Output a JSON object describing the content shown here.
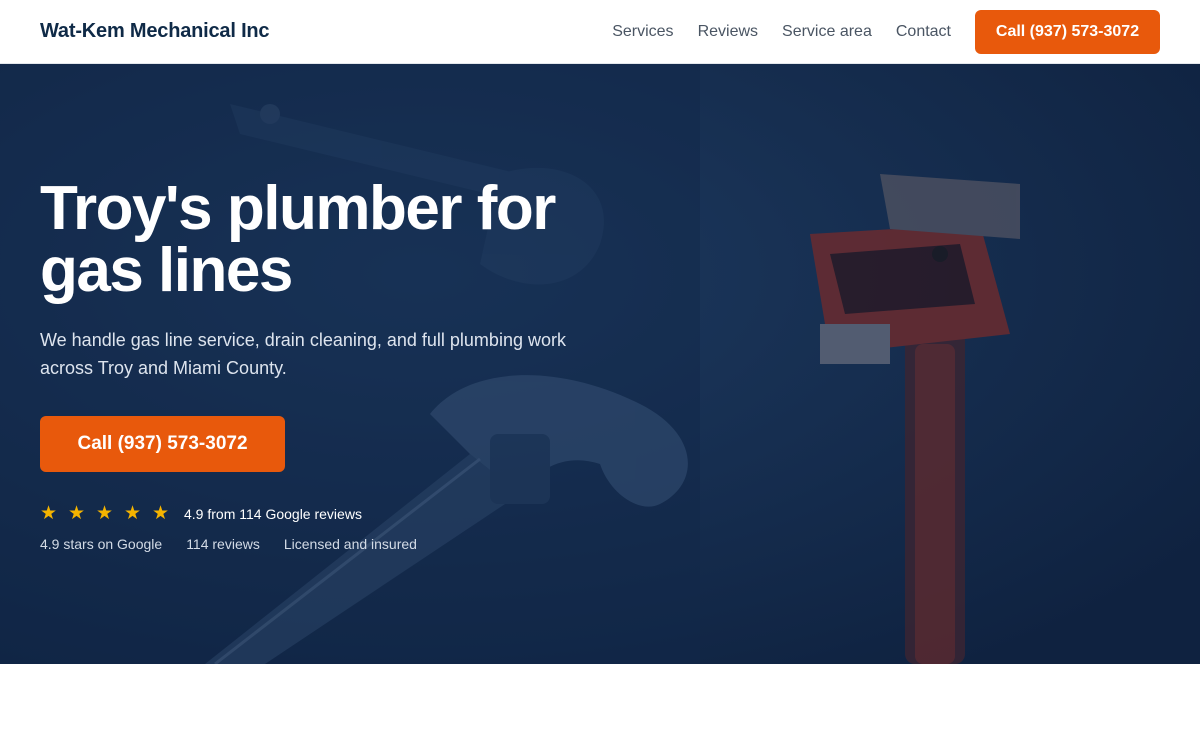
{
  "header": {
    "brand": "Wat-Kem Mechanical Inc",
    "nav": [
      "Services",
      "Reviews",
      "Service area",
      "Contact"
    ],
    "cta_label": "Call (937) 573-3072"
  },
  "hero": {
    "title_line1": "Troy's plumber for",
    "title_line2": "gas lines",
    "subtitle": "We handle gas line service, drain cleaning, and full plumbing work across Troy and Miami County.",
    "cta_label": "Call (937) 573-3072",
    "rating": {
      "stars": 5,
      "star_icon": "star-icon",
      "text": "4.9 from 114 Google reviews"
    },
    "trust": [
      "4.9 stars on Google",
      "114 reviews",
      "Licensed and insured"
    ],
    "background_image": "tools-photo (wrenches, dark navy overlay)"
  },
  "colors": {
    "navy": "#0f2a47",
    "hero_bg": "#13294a",
    "accent": "#e8590c",
    "star": "#f5b400"
  }
}
